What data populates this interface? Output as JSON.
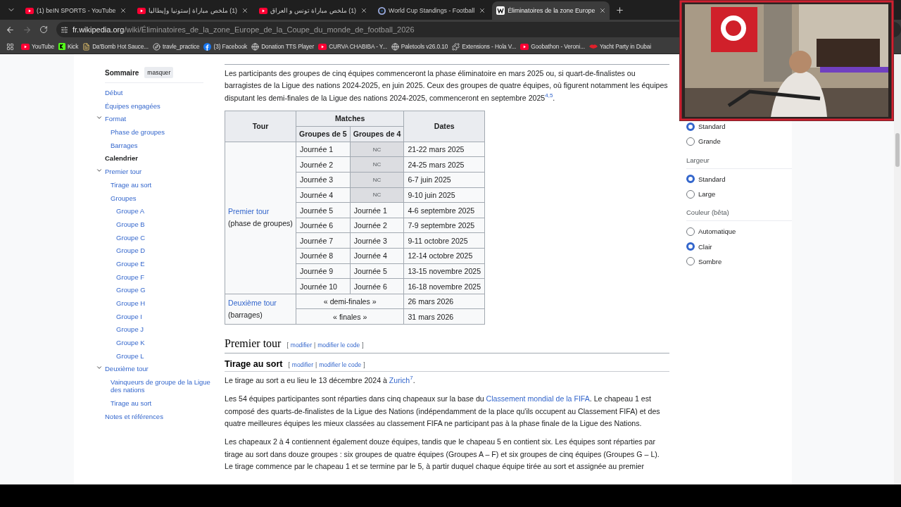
{
  "browser": {
    "tabs": [
      {
        "title": "(1) beIN SPORTS - YouTube",
        "kind": "youtube",
        "selected": false
      },
      {
        "title": "(1) ملخص مباراة إستونيا وإيطاليا",
        "kind": "youtube",
        "selected": false
      },
      {
        "title": "(1) ملخص مباراة تونس و العراق",
        "kind": "youtube",
        "selected": false
      },
      {
        "title": "World Cup Standings - Football",
        "kind": "site",
        "selected": false
      },
      {
        "title": "Éliminatoires de la zone Europe",
        "kind": "wiki",
        "selected": true
      }
    ],
    "address": {
      "domain": "fr.wikipedia.org",
      "path": "/wiki/Éliminatoires_de_la_zone_Europe_de_la_Coupe_du_monde_de_football_2026"
    },
    "bookmarks": [
      {
        "label": "YouTube",
        "kind": "youtube"
      },
      {
        "label": "Kick",
        "kind": "kick"
      },
      {
        "label": "Da'Bomb Hot Sauce...",
        "kind": "page"
      },
      {
        "label": "travle_practice",
        "kind": "compass"
      },
      {
        "label": "(3) Facebook",
        "kind": "facebook"
      },
      {
        "label": "Donation TTS Player",
        "kind": "globe"
      },
      {
        "label": "CURVA CHABIBA - Y...",
        "kind": "youtube"
      },
      {
        "label": "Paletools v26.0.10",
        "kind": "globe"
      },
      {
        "label": "Extensions - Hola V...",
        "kind": "puzzle"
      },
      {
        "label": "Goobathon - Veroni...",
        "kind": "youtube"
      },
      {
        "label": "Yacht Party in Dubai",
        "kind": "lips"
      }
    ]
  },
  "toc": {
    "title": "Sommaire",
    "hide_button": "masquer",
    "items": [
      {
        "label": "Début",
        "selected": false
      },
      {
        "label": "Équipes engagées",
        "selected": false
      },
      {
        "label": "Format",
        "selected": false,
        "expanded": true,
        "children": [
          {
            "label": "Phase de groupes",
            "selected": false
          },
          {
            "label": "Barrages",
            "selected": false
          }
        ]
      },
      {
        "label": "Calendrier",
        "selected": true
      },
      {
        "label": "Premier tour",
        "selected": false,
        "expanded": true,
        "children": [
          {
            "label": "Tirage au sort",
            "selected": false
          },
          {
            "label": "Groupes",
            "selected": false,
            "children": [
              {
                "label": "Groupe A",
                "selected": false
              },
              {
                "label": "Groupe B",
                "selected": false
              },
              {
                "label": "Groupe C",
                "selected": false
              },
              {
                "label": "Groupe D",
                "selected": false
              },
              {
                "label": "Groupe E",
                "selected": false
              },
              {
                "label": "Groupe F",
                "selected": false
              },
              {
                "label": "Groupe G",
                "selected": false
              },
              {
                "label": "Groupe H",
                "selected": false
              },
              {
                "label": "Groupe I",
                "selected": false
              },
              {
                "label": "Groupe J",
                "selected": false
              },
              {
                "label": "Groupe K",
                "selected": false
              },
              {
                "label": "Groupe L",
                "selected": false
              }
            ]
          }
        ]
      },
      {
        "label": "Deuxième tour",
        "selected": false,
        "expanded": true,
        "children": [
          {
            "label": "Vainqueurs de groupe de la Ligue des nations",
            "selected": false
          },
          {
            "label": "Tirage au sort",
            "selected": false
          }
        ]
      },
      {
        "label": "Notes et références",
        "selected": false
      }
    ]
  },
  "article": {
    "blocks": [
      {
        "kind": "paragraph",
        "segments": [
          {
            "kind": "text",
            "text": "Les participants des groupes de cinq équipes commenceront la phase éliminatoire en mars 2025 ou, si quart-de-finalistes ou barragistes de la Ligue des nations 2024-2025, en juin 2025. Ceux des groupes de quatre équipes, où figurent notamment les équipes disputant les demi-finales de la Ligue des nations 2024-2025, commenceront en septembre 2025"
          },
          {
            "kind": "sup",
            "text": "4,5"
          },
          {
            "kind": "text",
            "text": "."
          }
        ]
      },
      {
        "kind": "table",
        "header": {
          "tour": "Tour",
          "matches": "Matches",
          "group5": "Groupes de 5",
          "group4": "Groupes de 4",
          "dates": "Dates"
        },
        "sections": [
          {
            "tour_link": "Premier tour",
            "tour_note": "(phase de groupes)",
            "rows": [
              {
                "kind": "split",
                "group5": "Journée 1",
                "group4": {
                  "text": "NC",
                  "unplayed": true
                },
                "date": "21-22 mars 2025"
              },
              {
                "kind": "split",
                "group5": "Journée 2",
                "group4": {
                  "text": "NC",
                  "unplayed": true
                },
                "date": "24-25 mars 2025"
              },
              {
                "kind": "split",
                "group5": "Journée 3",
                "group4": {
                  "text": "NC",
                  "unplayed": true
                },
                "date": "6-7 juin 2025"
              },
              {
                "kind": "split",
                "group5": "Journée 4",
                "group4": {
                  "text": "NC",
                  "unplayed": true
                },
                "date": "9-10 juin 2025"
              },
              {
                "kind": "split",
                "group5": "Journée 5",
                "group4": {
                  "text": "Journée 1",
                  "unplayed": false
                },
                "date": "4-6 septembre 2025"
              },
              {
                "kind": "split",
                "group5": "Journée 6",
                "group4": {
                  "text": "Journée 2",
                  "unplayed": false
                },
                "date": "7-9 septembre 2025"
              },
              {
                "kind": "split",
                "group5": "Journée 7",
                "group4": {
                  "text": "Journée 3",
                  "unplayed": false
                },
                "date": "9-11 octobre 2025"
              },
              {
                "kind": "split",
                "group5": "Journée 8",
                "group4": {
                  "text": "Journée 4",
                  "unplayed": false
                },
                "date": "12-14 octobre 2025"
              },
              {
                "kind": "split",
                "group5": "Journée 9",
                "group4": {
                  "text": "Journée 5",
                  "unplayed": false
                },
                "date": "13-15 novembre 2025"
              },
              {
                "kind": "split",
                "group5": "Journée 10",
                "group4": {
                  "text": "Journée 6",
                  "unplayed": false
                },
                "date": "16-18 novembre 2025"
              }
            ]
          },
          {
            "tour_link": "Deuxième tour",
            "tour_note": "(barrages)",
            "rows": [
              {
                "kind": "merged",
                "text": "« demi-finales »",
                "date": "26 mars 2026"
              },
              {
                "kind": "merged",
                "text": "« finales »",
                "date": "31 mars 2026"
              }
            ]
          }
        ]
      },
      {
        "kind": "heading2",
        "title": "Premier tour",
        "edit": {
          "open": "[",
          "links": [
            "modifier",
            "modifier le code"
          ],
          "separator": "|",
          "close": "]"
        }
      },
      {
        "kind": "heading3",
        "title": "Tirage au sort",
        "edit": {
          "open": "[",
          "links": [
            "modifier",
            "modifier le code"
          ],
          "separator": "|",
          "close": "]"
        }
      },
      {
        "kind": "paragraph",
        "segments": [
          {
            "kind": "text",
            "text": "Le tirage au sort a eu lieu le 13 décembre 2024 à "
          },
          {
            "kind": "link",
            "text": "Zurich"
          },
          {
            "kind": "sup",
            "text": "7"
          },
          {
            "kind": "text",
            "text": "."
          }
        ]
      },
      {
        "kind": "paragraph",
        "segments": [
          {
            "kind": "text",
            "text": "Les 54 équipes participantes sont réparties dans cinq chapeaux sur la base du "
          },
          {
            "kind": "link",
            "text": "Classement mondial de la FIFA"
          },
          {
            "kind": "text",
            "text": ". Le chapeau 1 est composé des quarts-de-finalistes de la Ligue des Nations (indépendamment de la place qu'ils occupent au Classement FIFA) et des quatre meilleures équipes les mieux classées au classement FIFA ne participant pas à la phase finale de la Ligue des Nations."
          }
        ]
      },
      {
        "kind": "paragraph",
        "segments": [
          {
            "kind": "text",
            "text": "Les chapeaux 2 à 4 contiennent également douze équipes, tandis que le chapeau 5 en contient six. Les équipes sont réparties par tirage au sort dans douze groupes : six groupes de quatre équipes (Groupes A – F) et six groupes de cinq équipes (Groupes G – L). Le tirage commence par le chapeau 1 et se termine par le 5, à partir duquel chaque équipe tirée au sort et assignée au premier"
          }
        ]
      }
    ]
  },
  "appearance": {
    "groups": [
      {
        "options": [
          {
            "label": "Standard",
            "selected": true
          },
          {
            "label": "Grande",
            "selected": false
          }
        ]
      },
      {
        "label": "Largeur",
        "options": [
          {
            "label": "Standard",
            "selected": true
          },
          {
            "label": "Large",
            "selected": false
          }
        ]
      },
      {
        "label": "Couleur (bêta)",
        "options": [
          {
            "label": "Automatique",
            "selected": false
          },
          {
            "label": "Clair",
            "selected": true
          },
          {
            "label": "Sombre",
            "selected": false
          }
        ]
      }
    ]
  }
}
